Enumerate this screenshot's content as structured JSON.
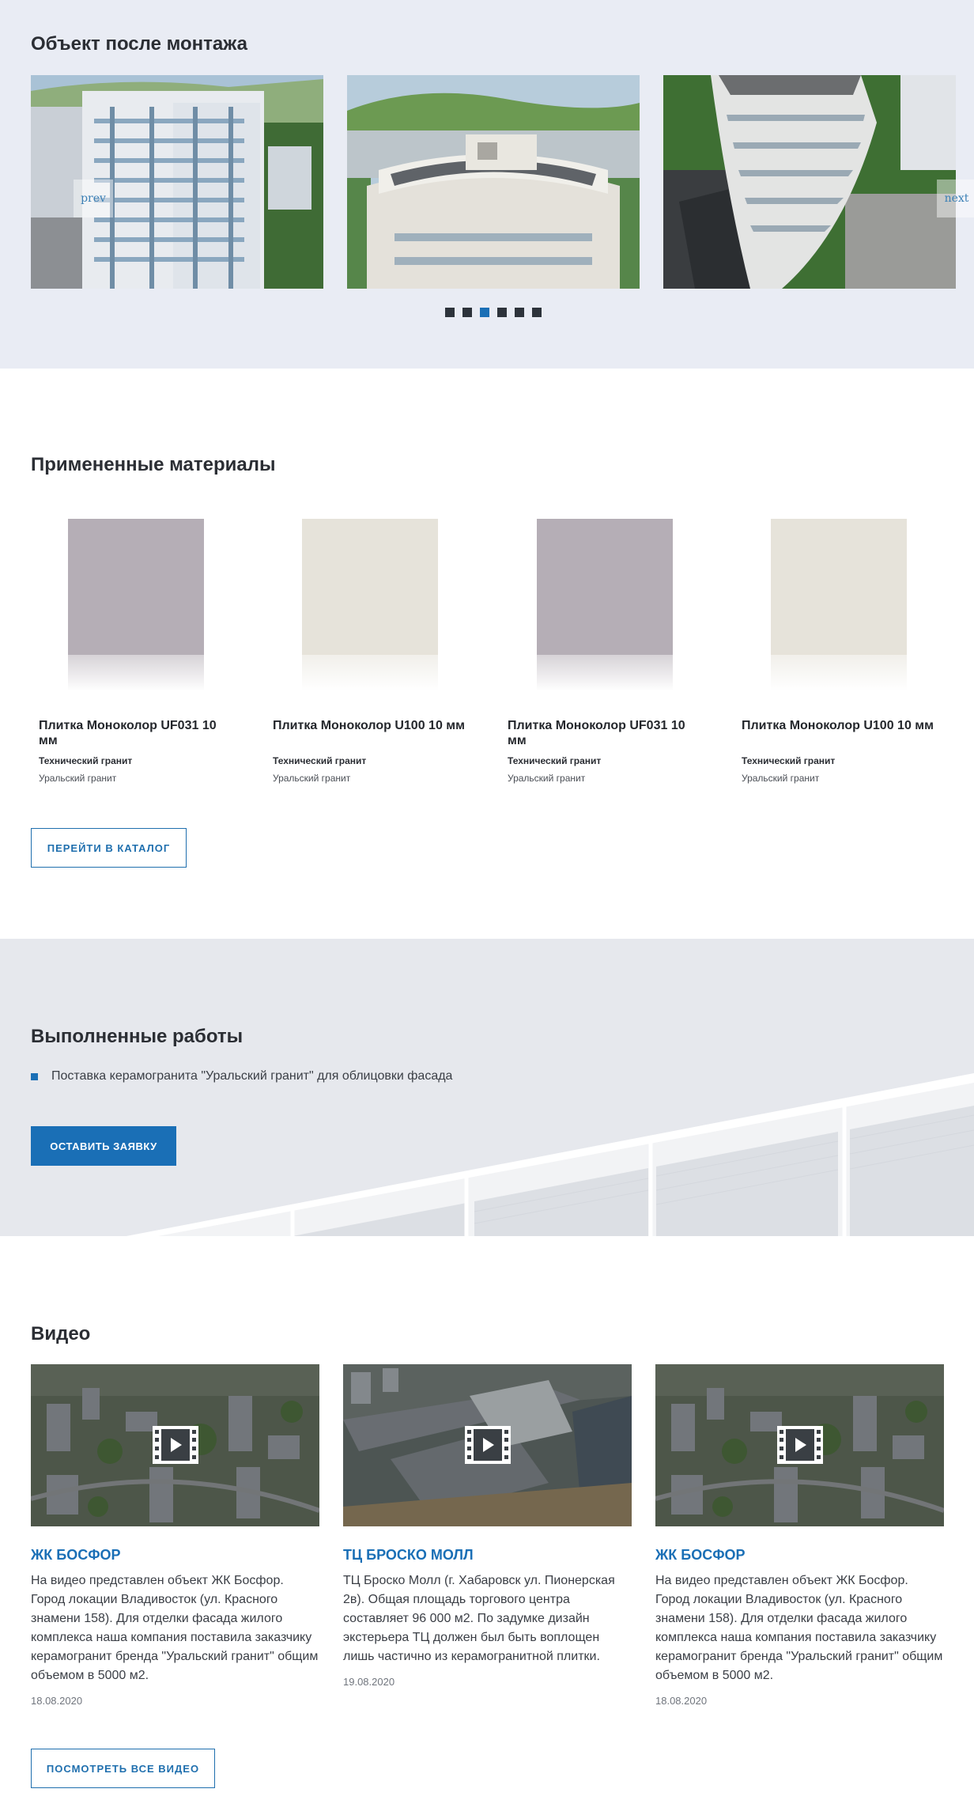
{
  "object_section": {
    "title": "Объект после монтажа",
    "prev_label": "prev",
    "next_label": "next",
    "slides": [
      {
        "alt": "building-photo-1"
      },
      {
        "alt": "building-photo-2"
      },
      {
        "alt": "building-photo-3"
      }
    ],
    "dots_count": 6,
    "active_dot": 2
  },
  "materials_section": {
    "title": "Примененные материалы",
    "products": [
      {
        "title": "Плитка Моноколор UF031 10 мм",
        "type": "Технический гранит",
        "brand": "Уральский гранит",
        "color": "#b5aeb6"
      },
      {
        "title": "Плитка Моноколор U100 10 мм",
        "type": "Технический гранит",
        "brand": "Уральский гранит",
        "color": "#e6e3da"
      },
      {
        "title": "Плитка Моноколор UF031 10 мм",
        "type": "Технический гранит",
        "brand": "Уральский гранит",
        "color": "#b5aeb6"
      },
      {
        "title": "Плитка Моноколор U100 10 мм",
        "type": "Технический гранит",
        "brand": "Уральский гранит",
        "color": "#e6e3da"
      }
    ],
    "catalog_button": "ПЕРЕЙТИ В КАТАЛОГ"
  },
  "works_section": {
    "title": "Выполненные работы",
    "items": [
      "Поставка керамогранита \"Уральский гранит\" для облицовки фасада"
    ],
    "request_button": "ОСТАВИТЬ ЗАЯВКУ"
  },
  "video_section": {
    "title": "Видео",
    "videos": [
      {
        "title": "ЖК БОСФОР",
        "description": "На видео представлен объект ЖК Босфор. Город локации Владивосток (ул. Красного знамени 158). Для отделки фасада жилого комплекса наша компания поставила заказчику керамогранит бренда \"Уральский гранит\" общим объемом в 5000 м2.",
        "date": "18.08.2020"
      },
      {
        "title": "ТЦ БРОСКО МОЛЛ",
        "description": "ТЦ Броско Молл (г. Хабаровск ул. Пионерская 2в). Общая площадь торгового центра составляет 96 000 м2. По задумке дизайн экстерьера ТЦ должен был быть воплощен лишь частично из керамогранитной плитки.",
        "date": "19.08.2020"
      },
      {
        "title": "ЖК БОСФОР",
        "description": "На видео представлен объект ЖК Босфор. Город локации Владивосток (ул. Красного знамени 158). Для отделки фасада жилого комплекса наша компания поставила заказчику керамогранит бренда \"Уральский гранит\" общим объемом в 5000 м2.",
        "date": "18.08.2020"
      }
    ],
    "all_videos_button": "ПОСМОТРЕТЬ ВСЕ ВИДЕО"
  },
  "colors": {
    "accent": "#1a6fb6",
    "section_bg": "#e9ecf4",
    "dot_inactive": "#2d333b"
  }
}
